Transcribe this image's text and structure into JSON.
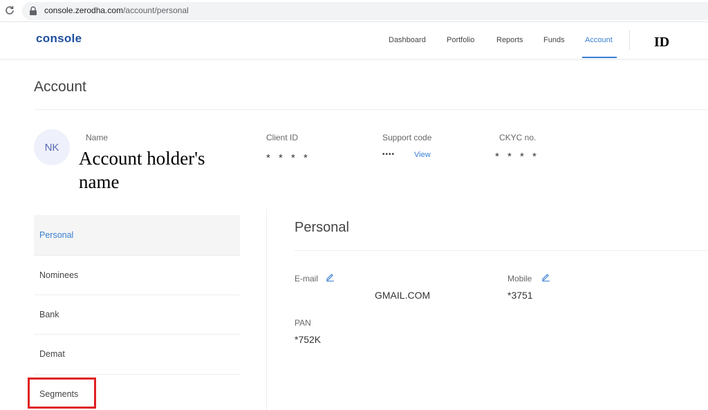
{
  "browser": {
    "url_host": "console.zerodha.com",
    "url_path": "/account/personal"
  },
  "header": {
    "logo": "console",
    "nav": [
      "Dashboard",
      "Portfolio",
      "Reports",
      "Funds",
      "Account"
    ],
    "active_nav": "Account",
    "user_id": "ID"
  },
  "page": {
    "title": "Account"
  },
  "profile": {
    "avatar_initials": "NK",
    "name_label": "Name",
    "name_value": "Account holder's name",
    "client_id_label": "Client ID",
    "client_id_value": "* * * *",
    "support_code_label": "Support code",
    "support_code_value": "••••",
    "support_code_link": "View",
    "ckyc_label": "CKYC no.",
    "ckyc_value": "* * * *"
  },
  "side_menu": {
    "items": [
      "Personal",
      "Nominees",
      "Bank",
      "Demat",
      "Segments"
    ],
    "active": "Personal",
    "highlighted": "Segments"
  },
  "personal": {
    "title": "Personal",
    "email_label": "E-mail",
    "email_value": "GMAIL.COM",
    "mobile_label": "Mobile",
    "mobile_value": "*3751",
    "pan_label": "PAN",
    "pan_value": "*752K"
  },
  "colors": {
    "accent": "#387ed1",
    "logo": "#1d4e9e",
    "highlight": "#e02020"
  }
}
